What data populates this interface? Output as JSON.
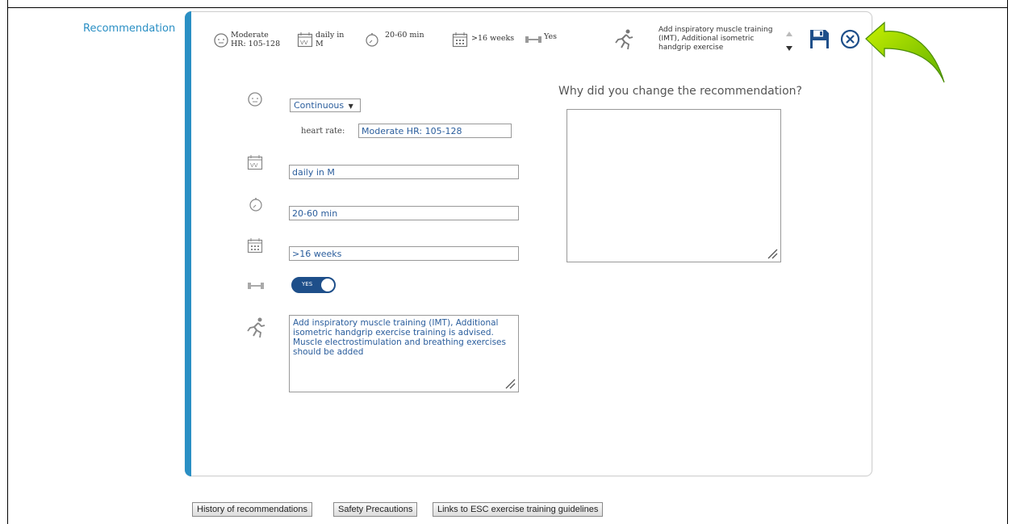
{
  "section_label": "Recommendation",
  "summary": {
    "intensity_line1": "Moderate",
    "intensity_line2": "HR: 105-128",
    "frequency_line1": "daily in",
    "frequency_line2": "M",
    "duration": "20-60 min",
    "period": ">16 weeks",
    "resistance": "Yes",
    "additional": "Add inspiratory muscle training (IMT), Additional isometric handgrip exercise"
  },
  "form": {
    "type_select": "Continuous",
    "heart_rate_label": "heart rate:",
    "heart_rate_value": "Moderate HR: 105-128",
    "frequency_value": "daily in M",
    "duration_value": "20-60 min",
    "period_value": ">16 weeks",
    "resistance_toggle": "YES",
    "additional_text": "Add inspiratory muscle training (IMT), Additional isometric handgrip exercise training is advised. Muscle electrostimulation and breathing exercises should be added"
  },
  "change_reason": {
    "question": "Why did you change the recommendation?",
    "value": ""
  },
  "buttons": {
    "history": "History of recommendations",
    "safety": "Safety Precautions",
    "links": "Links to ESC exercise training guidelines"
  },
  "colors": {
    "accent": "#2a8fc4",
    "toggle": "#1e4f8a",
    "field_text": "#2a5d9c",
    "arrow": "#8fd400"
  }
}
